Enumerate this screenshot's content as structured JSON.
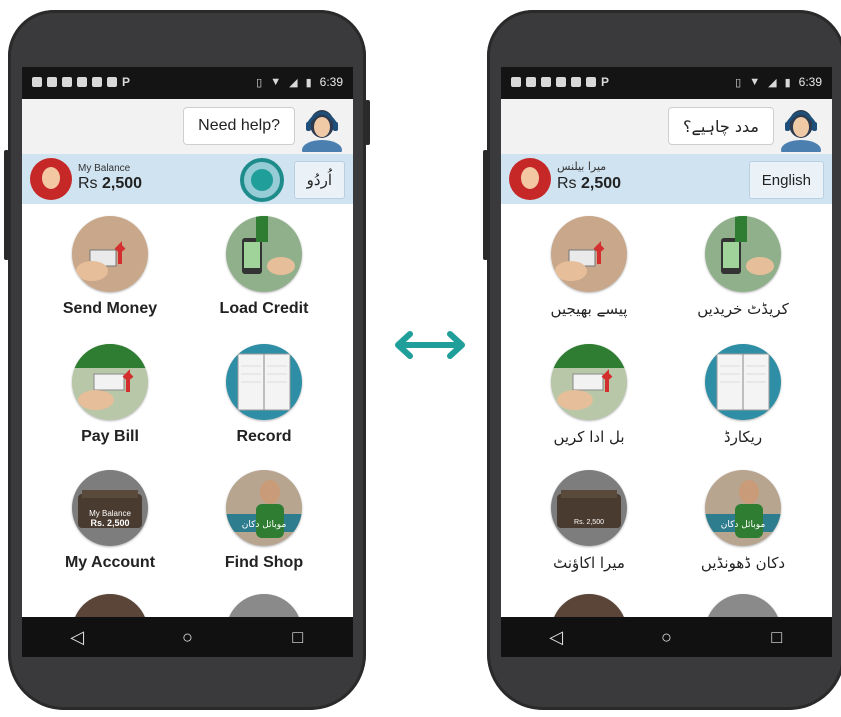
{
  "status_bar": {
    "time": "6:39"
  },
  "left_phone": {
    "help_text": "Need help?",
    "balance_label": "My Balance",
    "balance_currency": "Rs",
    "balance_amount": "2,500",
    "language_button": "اُردُو",
    "tiles": [
      {
        "label": "Send Money",
        "icon": "send-money-icon"
      },
      {
        "label": "Load Credit",
        "icon": "load-credit-icon"
      },
      {
        "label": "Pay Bill",
        "icon": "pay-bill-icon"
      },
      {
        "label": "Record",
        "icon": "record-icon"
      },
      {
        "label": "My Account",
        "icon": "my-account-icon",
        "sub_label": "My Balance",
        "sub_amount": "Rs. 2,500"
      },
      {
        "label": "Find Shop",
        "icon": "find-shop-icon",
        "sign_text": "موبائل دکان"
      }
    ]
  },
  "right_phone": {
    "help_text": "مدد چاہیے؟",
    "balance_label": "میرا بیلنس",
    "balance_currency": "Rs",
    "balance_amount": "2,500",
    "language_button": "English",
    "tiles": [
      {
        "label": "پیسے بھیجیں",
        "icon": "send-money-icon"
      },
      {
        "label": "کریڈٹ خریدیں",
        "icon": "load-credit-icon"
      },
      {
        "label": "بل ادا کریں",
        "icon": "pay-bill-icon"
      },
      {
        "label": "ریکارڈ",
        "icon": "record-icon"
      },
      {
        "label": "میرا اکاؤنٹ",
        "icon": "my-account-icon",
        "sub_amount": "Rs. 2,500"
      },
      {
        "label": "دکان ڈھونڈیں",
        "icon": "find-shop-icon",
        "sign_text": "موبائل دکان"
      }
    ]
  },
  "nav": {
    "back": "◁",
    "home": "○",
    "recents": "□"
  },
  "colors": {
    "accent": "#1f9e9a",
    "balance_bar": "#cfe3f1",
    "phone_body": "#3a3a3c"
  }
}
